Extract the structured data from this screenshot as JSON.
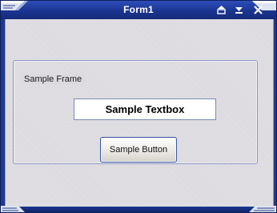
{
  "window": {
    "title": "Form1"
  },
  "frame": {
    "label": "Sample Frame"
  },
  "textbox": {
    "value": "Sample Textbox"
  },
  "button": {
    "label": "Sample Button"
  },
  "controls": {
    "restore_icon": "restore-icon",
    "minimize_icon": "minimize-icon",
    "close_icon": "close-icon"
  },
  "colors": {
    "titlebar": "#1f3a8a",
    "client_background": "#dcdadf",
    "accent_border": "#3b57a6"
  }
}
